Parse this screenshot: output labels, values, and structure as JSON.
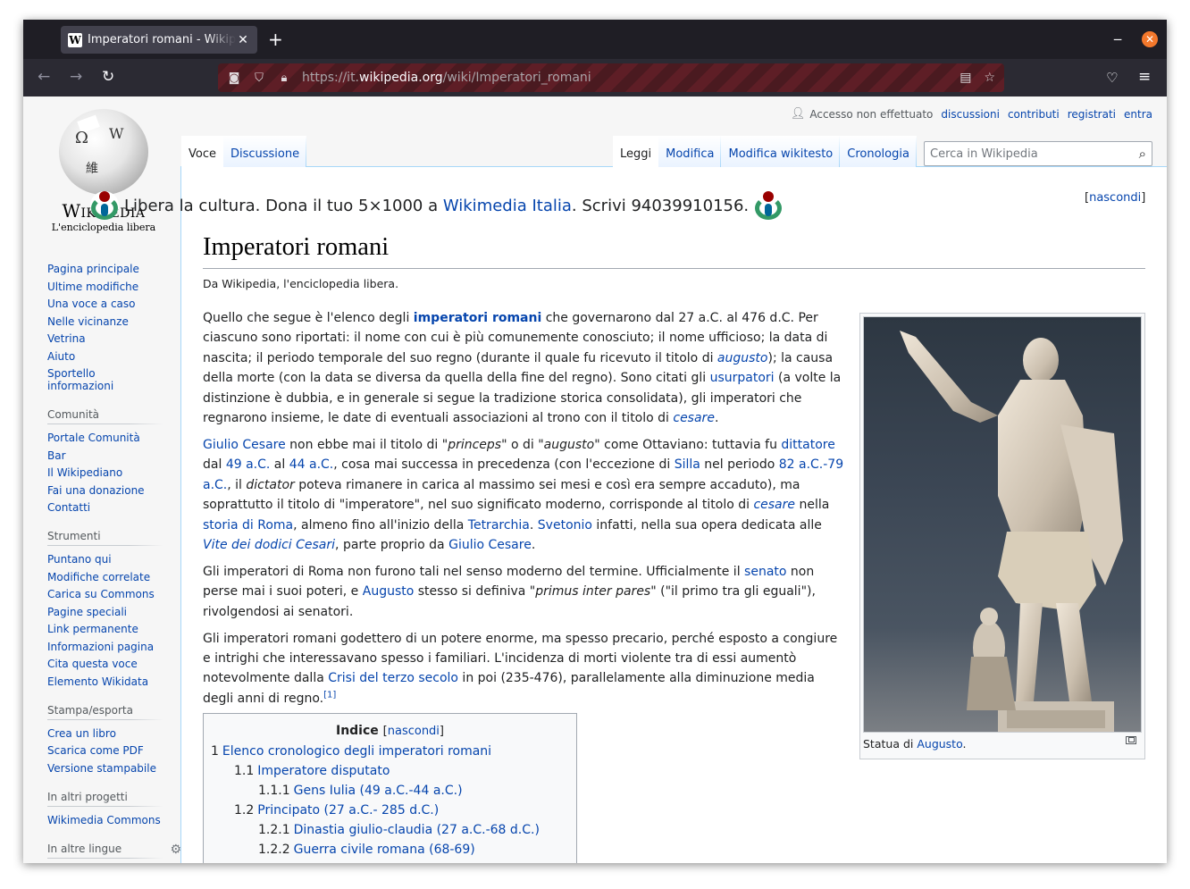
{
  "browser": {
    "tab_title": "Imperatori romani - Wikipedia",
    "favicon_letter": "W",
    "url_prefix": "https://it.",
    "url_domain": "wikipedia.org",
    "url_path": "/wiki/Imperatori_romani",
    "accent_close": "#f3782c"
  },
  "logo": {
    "wordmark": "Wikipedia",
    "tagline": "L'enciclopedia libera",
    "globe_glyphs": [
      "Ω",
      "W",
      "維"
    ]
  },
  "personal_tools": {
    "anon_label": "Accesso non effettuato",
    "links": [
      "discussioni",
      "contributi",
      "registrati",
      "entra"
    ]
  },
  "tabs": {
    "left": [
      "Voce",
      "Discussione"
    ],
    "right": [
      "Leggi",
      "Modifica",
      "Modifica wikitesto",
      "Cronologia"
    ]
  },
  "search": {
    "placeholder": "Cerca in Wikipedia"
  },
  "sidebar": {
    "main": [
      "Pagina principale",
      "Ultime modifiche",
      "Una voce a caso",
      "Nelle vicinanze",
      "Vetrina",
      "Aiuto",
      "Sportello informazioni"
    ],
    "community_heading": "Comunità",
    "community": [
      "Portale Comunità",
      "Bar",
      "Il Wikipediano",
      "Fai una donazione",
      "Contatti"
    ],
    "tools_heading": "Strumenti",
    "tools": [
      "Puntano qui",
      "Modifiche correlate",
      "Carica su Commons",
      "Pagine speciali",
      "Link permanente",
      "Informazioni pagina",
      "Cita questa voce",
      "Elemento Wikidata"
    ],
    "print_heading": "Stampa/esporta",
    "print": [
      "Crea un libro",
      "Scarica come PDF",
      "Versione stampabile"
    ],
    "projects_heading": "In altri progetti",
    "projects": [
      "Wikimedia Commons"
    ],
    "languages_heading": "In altre lingue"
  },
  "banner": {
    "text_before": "Libera la cultura. Dona il tuo 5×1000 a ",
    "link": "Wikimedia Italia",
    "text_after": ". Scrivi 94039910156.",
    "hide_open": "[",
    "hide_link": "nascondi",
    "hide_close": "]"
  },
  "article": {
    "title": "Imperatori romani",
    "sitesub": "Da Wikipedia, l'enciclopedia libera."
  },
  "thumb": {
    "caption_before": "Statua di ",
    "caption_link": "Augusto",
    "caption_after": "."
  },
  "toc": {
    "title": "Indice",
    "hide_link": "nascondi",
    "rows": [
      {
        "num": "1",
        "text": "Elenco cronologico degli imperatori romani",
        "level": 0
      },
      {
        "num": "1.1",
        "text": "Imperatore disputato",
        "level": 1
      },
      {
        "num": "1.1.1",
        "text": "Gens Iulia (49 a.C.-44 a.C.)",
        "level": 2
      },
      {
        "num": "1.2",
        "text": "Principato (27 a.C.- 285 d.C.)",
        "level": 1
      },
      {
        "num": "1.2.1",
        "text": "Dinastia giulio-claudia (27 a.C.-68 d.C.)",
        "level": 2
      },
      {
        "num": "1.2.2",
        "text": "Guerra civile romana (68-69)",
        "level": 2
      }
    ]
  }
}
